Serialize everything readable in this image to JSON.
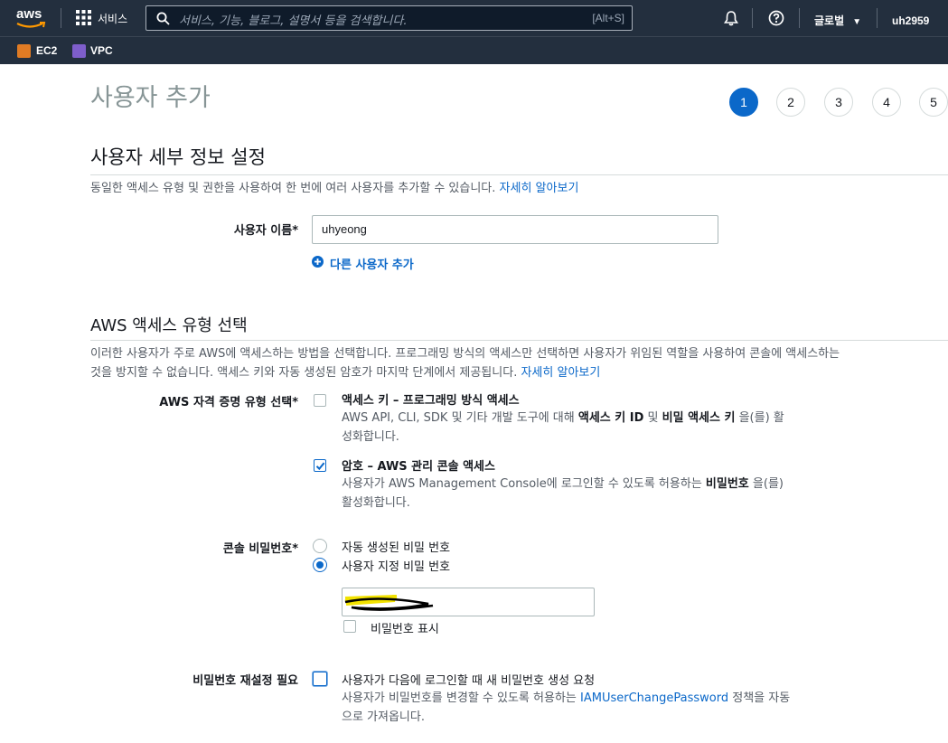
{
  "nav": {
    "logo": "aws",
    "services": "서비스",
    "search_placeholder": "서비스, 기능, 블로그, 설명서 등을 검색합니다.",
    "search_shortcut": "[Alt+S]",
    "region": "글로벌",
    "user": "uh2959",
    "favorites": [
      {
        "label": "EC2",
        "color": "#e07b24",
        "icon": "ec2-icon"
      },
      {
        "label": "VPC",
        "color": "#7e5ecb",
        "icon": "vpc-icon"
      }
    ]
  },
  "page": {
    "title": "사용자 추가",
    "steps": [
      "1",
      "2",
      "3",
      "4",
      "5"
    ],
    "active_step": "1"
  },
  "details": {
    "heading": "사용자 세부 정보 설정",
    "description": "동일한 액세스 유형 및 권한을 사용하여 한 번에 여러 사용자를 추가할 수 있습니다.",
    "learn_more": "자세히 알아보기",
    "username_label": "사용자 이름*",
    "username_value": "uhyeong",
    "add_user": "다른 사용자 추가"
  },
  "access": {
    "heading": "AWS 액세스 유형 선택",
    "description_1": "이러한 사용자가 주로 AWS에 액세스하는 방법을 선택합니다. 프로그래밍 방식의 액세스만 선택하면 사용자가 위임된 역할을 사용하여 콘솔에 액세스하는",
    "description_2": "것을 방지할 수 없습니다. 액세스 키와 자동 생성된 암호가 마지막 단계에서 제공됩니다.",
    "learn_more": "자세히 알아보기",
    "cred_label": "AWS 자격 증명 유형 선택*",
    "option1_title": "액세스 키 – 프로그래밍 방식 액세스",
    "option1_desc_a": "AWS API, CLI, SDK 및 기타 개발 도구에 대해",
    "option1_desc_b": "액세스 키 ID",
    "option1_desc_c": "및",
    "option1_desc_d": "비밀 액세스 키",
    "option1_desc_e": "을(를) 활",
    "option1_desc_f": "성화합니다.",
    "option1_checked": false,
    "option2_title": "암호 – AWS 관리 콘솔 액세스",
    "option2_desc_a": "사용자가 AWS Management Console에 로그인할 수 있도록 허용하는",
    "option2_desc_b": "비밀번호",
    "option2_desc_c": "을(를)",
    "option2_desc_d": "활성화합니다.",
    "option2_checked": true
  },
  "password": {
    "label": "콘솔 비밀번호*",
    "auto": "자동 생성된 비밀 번호",
    "custom": "사용자 지정 비밀 번호",
    "selected": "custom",
    "show_label": "비밀번호 표시",
    "reset_label": "비밀번호 재설정 필요",
    "reset_text": "사용자가 다음에 로그인할 때 새 비밀번호 생성 요청",
    "reset_desc_a": "사용자가 비밀번호를 변경할 수 있도록 허용하는",
    "reset_link": "IAMUserChangePassword",
    "reset_desc_b": "정책을 자동",
    "reset_desc_c": "으로 가져옵니다."
  }
}
